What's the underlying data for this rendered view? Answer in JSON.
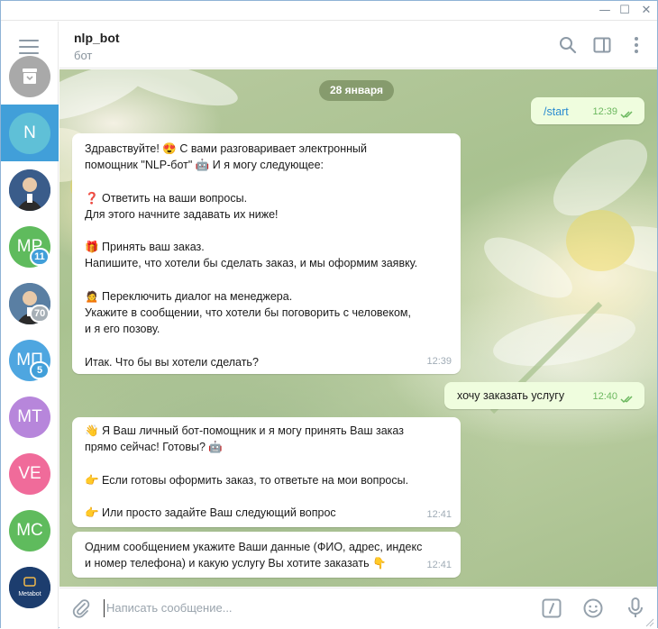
{
  "window": {
    "minimize": "—",
    "maximize": "☐",
    "close": "✕"
  },
  "sidebar": {
    "chats": [
      {
        "initials": "",
        "color": "#a9a9a9",
        "kind": "archive"
      },
      {
        "initials": "N",
        "color": "#5fc0d7",
        "kind": "active"
      },
      {
        "initials": "",
        "color": "#3a5c8a",
        "kind": "photo"
      },
      {
        "initials": "MP",
        "color": "#5fbb5d",
        "badge": "11",
        "badge_color": "#419fd9"
      },
      {
        "initials": "",
        "color": "#5a7fa3",
        "kind": "photo",
        "badge": "70",
        "badge_color": "#a6afb6"
      },
      {
        "initials": "МП",
        "color": "#4ea6e0",
        "badge": "5",
        "badge_color": "#419fd9"
      },
      {
        "initials": "MT",
        "color": "#b786db",
        "kind": ""
      },
      {
        "initials": "VE",
        "color": "#f06b9a",
        "kind": ""
      },
      {
        "initials": "MC",
        "color": "#5fbb5d",
        "kind": ""
      },
      {
        "initials": "",
        "color": "#1c3d6e",
        "kind": "logo",
        "logo_text": "Metabot"
      }
    ]
  },
  "header": {
    "name": "nlp_bot",
    "subtitle": "бот"
  },
  "chat": {
    "date": "28 января",
    "messages": [
      {
        "dir": "out",
        "lines": [
          "/start"
        ],
        "time": "12:39",
        "link": true
      },
      {
        "dir": "in",
        "time": "12:39",
        "lines": [
          "Здравствуйте! 😍 С вами разговаривает электронный",
          "помощник \"NLP-бот\" 🤖 И я могу следующее:",
          "",
          "❓ Ответить на ваши вопросы.",
          "Для этого начните задавать их ниже!",
          "",
          "🎁 Принять ваш заказ.",
          "Напишите, что хотели бы сделать заказ, и мы оформим заявку.",
          "",
          "🙍 Переключить диалог на менеджера.",
          "Укажите в сообщении, что хотели бы поговорить с человеком,",
          "и я его позову.",
          "",
          "Итак. Что бы вы хотели сделать?"
        ]
      },
      {
        "dir": "out",
        "lines": [
          "хочу заказать услугу"
        ],
        "time": "12:40"
      },
      {
        "dir": "in",
        "time": "12:41",
        "lines": [
          "👋 Я Ваш личный бот-помощник и я могу принять Ваш заказ",
          "прямо сейчас! Готовы? 🤖",
          "",
          "👉 Если готовы оформить заказ, то ответьте на мои вопросы.",
          "",
          "👉 Или просто задайте Ваш следующий вопрос"
        ]
      },
      {
        "dir": "in",
        "time": "12:41",
        "lines": [
          "Одним сообщением укажите Ваши данные (ФИО, адрес, индекс",
          "и номер телефона)  и какую услугу Вы хотите заказать 👇"
        ]
      }
    ]
  },
  "input": {
    "placeholder": "Написать сообщение..."
  },
  "colors": {
    "accent": "#419fd9",
    "outgoing": "#effdde",
    "ticks": "#6cb85f"
  }
}
